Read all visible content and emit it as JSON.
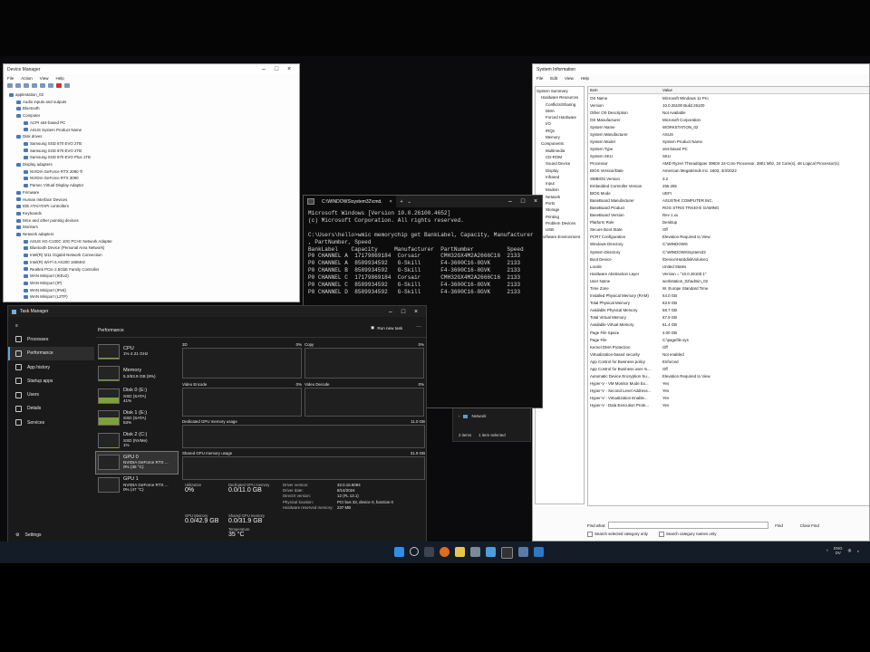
{
  "device_manager": {
    "title": "Device Manager",
    "menu": [
      "File",
      "Action",
      "View",
      "Help"
    ],
    "tree": [
      {
        "label": "applestation_02",
        "indent": 0
      },
      {
        "label": "Audio inputs and outputs",
        "indent": 1
      },
      {
        "label": "Bluetooth",
        "indent": 1
      },
      {
        "label": "Computer",
        "indent": 1
      },
      {
        "label": "ACPI x64-based PC",
        "indent": 2
      },
      {
        "label": "ASUS System Product Name",
        "indent": 2
      },
      {
        "label": "Disk drives",
        "indent": 1
      },
      {
        "label": "Samsung SSD 870 EVO 2TB",
        "indent": 2
      },
      {
        "label": "Samsung SSD 870 EVO 2TB",
        "indent": 2
      },
      {
        "label": "Samsung SSD 970 EVO Plus 1TB",
        "indent": 2
      },
      {
        "label": "Display adapters",
        "indent": 1
      },
      {
        "label": "NVIDIA GeForce RTX 2080 Ti",
        "indent": 2
      },
      {
        "label": "NVIDIA GeForce RTX 3090",
        "indent": 2
      },
      {
        "label": "Parsec Virtual Display Adapter",
        "indent": 2
      },
      {
        "label": "Firmware",
        "indent": 1
      },
      {
        "label": "Human Interface Devices",
        "indent": 1
      },
      {
        "label": "IDE ATA/ATAPI controllers",
        "indent": 1
      },
      {
        "label": "Keyboards",
        "indent": 1
      },
      {
        "label": "Mice and other pointing devices",
        "indent": 1
      },
      {
        "label": "Monitors",
        "indent": 1
      },
      {
        "label": "Network adapters",
        "indent": 1
      },
      {
        "label": "ASUS XG-C100C 10G PCI-E Network Adapter",
        "indent": 2
      },
      {
        "label": "Bluetooth Device (Personal Area Network)",
        "indent": 2
      },
      {
        "label": "Intel(R) I211 Gigabit Network Connection",
        "indent": 2
      },
      {
        "label": "Intel(R) Wi-Fi 6 AX200 160MHz",
        "indent": 2
      },
      {
        "label": "Realtek PCIe 2.5GbE Family Controller",
        "indent": 2
      },
      {
        "label": "WAN Miniport (IKEv2)",
        "indent": 2
      },
      {
        "label": "WAN Miniport (IP)",
        "indent": 2
      },
      {
        "label": "WAN Miniport (IPv6)",
        "indent": 2
      },
      {
        "label": "WAN Miniport (L2TP)",
        "indent": 2
      }
    ]
  },
  "system_info": {
    "title": "System Information",
    "menu": [
      "File",
      "Edit",
      "View",
      "Help"
    ],
    "tree": [
      {
        "label": "System Summary",
        "indent": 0
      },
      {
        "label": "Hardware Resources",
        "indent": 1
      },
      {
        "label": "Conflicts/Sharing",
        "indent": 2
      },
      {
        "label": "DMA",
        "indent": 2
      },
      {
        "label": "Forced Hardware",
        "indent": 2
      },
      {
        "label": "I/O",
        "indent": 2
      },
      {
        "label": "IRQs",
        "indent": 2
      },
      {
        "label": "Memory",
        "indent": 2
      },
      {
        "label": "Components",
        "indent": 1
      },
      {
        "label": "Multimedia",
        "indent": 2
      },
      {
        "label": "CD-ROM",
        "indent": 2
      },
      {
        "label": "Sound Device",
        "indent": 2
      },
      {
        "label": "Display",
        "indent": 2
      },
      {
        "label": "Infrared",
        "indent": 2
      },
      {
        "label": "Input",
        "indent": 2
      },
      {
        "label": "Modem",
        "indent": 2
      },
      {
        "label": "Network",
        "indent": 2
      },
      {
        "label": "Ports",
        "indent": 2
      },
      {
        "label": "Storage",
        "indent": 2
      },
      {
        "label": "Printing",
        "indent": 2
      },
      {
        "label": "Problem Devices",
        "indent": 2
      },
      {
        "label": "USB",
        "indent": 2
      },
      {
        "label": "Software Environment",
        "indent": 1
      }
    ],
    "columns": [
      "Item",
      "Value"
    ],
    "rows": [
      [
        "OS Name",
        "Microsoft Windows 11 Pro"
      ],
      [
        "Version",
        "10.0.26100 Build 26100"
      ],
      [
        "Other OS Description",
        "Not Available"
      ],
      [
        "OS Manufacturer",
        "Microsoft Corporation"
      ],
      [
        "System Name",
        "WORKSTATION_02"
      ],
      [
        "System Manufacturer",
        "ASUS"
      ],
      [
        "System Model",
        "System Product Name"
      ],
      [
        "System Type",
        "x64-based PC"
      ],
      [
        "System SKU",
        "SKU"
      ],
      [
        "Processor",
        "AMD Ryzen Threadripper 3960X 24-Core Processor, 3801 Mhz, 24 Core(s), 48 Logical Processor(s)"
      ],
      [
        "BIOS Version/Date",
        "American Megatrends Inc. 1603, 3/4/2022"
      ],
      [
        "SMBIOS Version",
        "3.2"
      ],
      [
        "Embedded Controller Version",
        "255.255"
      ],
      [
        "BIOS Mode",
        "UEFI"
      ],
      [
        "BaseBoard Manufacturer",
        "ASUSTeK COMPUTER INC."
      ],
      [
        "BaseBoard Product",
        "ROG STRIX TRX40-E GAMING"
      ],
      [
        "BaseBoard Version",
        "Rev 1.xx"
      ],
      [
        "Platform Role",
        "Desktop"
      ],
      [
        "Secure Boot State",
        "Off"
      ],
      [
        "PCR7 Configuration",
        "Elevation Required to View"
      ],
      [
        "Windows Directory",
        "C:\\WINDOWS"
      ],
      [
        "System Directory",
        "C:\\WINDOWS\\system32"
      ],
      [
        "Boot Device",
        "\\Device\\HarddiskVolume1"
      ],
      [
        "Locale",
        "United States"
      ],
      [
        "Hardware Abstraction Layer",
        "Version = \"10.0.26100.1\""
      ],
      [
        "User Name",
        "workstation_02\\admin_02"
      ],
      [
        "Time Zone",
        "W. Europe Standard Time"
      ],
      [
        "Installed Physical Memory (RAM)",
        "64.0 GB"
      ],
      [
        "Total Physical Memory",
        "63.9 GB"
      ],
      [
        "Available Physical Memory",
        "58.7 GB"
      ],
      [
        "Total Virtual Memory",
        "67.9 GB"
      ],
      [
        "Available Virtual Memory",
        "61.4 GB"
      ],
      [
        "Page File Space",
        "4.00 GB"
      ],
      [
        "Page File",
        "C:\\pagefile.sys"
      ],
      [
        "Kernel DMA Protection",
        "Off"
      ],
      [
        "Virtualization-based security",
        "Not enabled"
      ],
      [
        "App Control for Business policy",
        "Enforced"
      ],
      [
        "App Control for Business user m...",
        "Off"
      ],
      [
        "Automatic Device Encryption Su...",
        "Elevation Required to View"
      ],
      [
        "Hyper-V - VM Monitor Mode Ex...",
        "Yes"
      ],
      [
        "Hyper-V - Second Level Address...",
        "Yes"
      ],
      [
        "Hyper-V - Virtualization Enable...",
        "Yes"
      ],
      [
        "Hyper-V - Data Execution Prote...",
        "Yes"
      ]
    ],
    "find_label": "Find what:",
    "find_button": "Find",
    "close_find_button": "Close Find",
    "check_selected": "Search selected category only",
    "check_names": "Search category names only"
  },
  "cmd": {
    "tab_title": "C:\\WINDOWS\\system32\\cmd.",
    "lines": [
      "Microsoft Windows [Version 10.0.26100.4652]",
      "(c) Microsoft Corporation. All rights reserved.",
      "",
      "C:\\Users\\hello>wmic memorychip get BankLabel, Capacity, Manufacturer",
      ", PartNumber, Speed",
      "BankLabel    Capacity     Manufacturer  PartNumber          Speed",
      "P0 CHANNEL A  17179869184  Corsair      CMH32GX4M2A2666C16  2133",
      "P0 CHANNEL A  8589934592   G-Skill      F4-3600C16-8GVK     2133",
      "P0 CHANNEL B  8589934592   G-Skill      F4-3600C16-8GVK     2133",
      "P0 CHANNEL C  17179869184  Corsair      CMH32GX4M2A2666C16  2133",
      "P0 CHANNEL C  8589934592   G-Skill      F4-3600C16-8GVK     2133",
      "P0 CHANNEL D  8589934592   G-Skill      F4-3600C16-8GVK     2133"
    ]
  },
  "explorer": {
    "item": "Network",
    "status_count": "2 items",
    "status_selected": "1 item selected"
  },
  "task_manager": {
    "title": "Task Manager",
    "section": "Performance",
    "run_task": "Run new task",
    "nav": [
      "Processes",
      "Performance",
      "App history",
      "Startup apps",
      "Users",
      "Details",
      "Services"
    ],
    "settings": "Settings",
    "resources": [
      {
        "name": "CPU",
        "sub": "1% 4.21 GHz",
        "fill": 0.02
      },
      {
        "name": "Memory",
        "sub": "5.2/63.9 GB (8%)",
        "fill": 0.08
      },
      {
        "name": "Disk 0 (E:)",
        "sub": "SSD (SATA)",
        "sub2": "41%",
        "fill": 0.41
      },
      {
        "name": "Disk 1 (E:)",
        "sub": "SSD (SATA)",
        "sub2": "53%",
        "fill": 0.53
      },
      {
        "name": "Disk 2 (C:)",
        "sub": "SSD (NVMe)",
        "sub2": "1%",
        "fill": 0.01
      },
      {
        "name": "GPU 0",
        "sub": "NVIDIA GeForce RTX ...",
        "sub2": "0% (35 °C)",
        "fill": 0
      },
      {
        "name": "GPU 1",
        "sub": "NVIDIA GeForce RTX ...",
        "sub2": "0% (47 °C)",
        "fill": 0
      }
    ],
    "graphs": {
      "g3d": "3D",
      "g3d_pct": "0%",
      "copy": "Copy",
      "copy_pct": "0%",
      "venc": "Video Encode",
      "venc_pct": "0%",
      "vdec": "Video Decode",
      "vdec_pct": "0%",
      "dedicated": "Dedicated GPU memory usage",
      "dedicated_max": "11.0 GB",
      "shared": "Shared GPU memory usage",
      "shared_max": "31.9 GB"
    },
    "stats": {
      "utilization_label": "Utilization",
      "utilization": "0%",
      "ded_label": "Dedicated GPU memory",
      "ded": "0.0/11.0 GB",
      "gpu_mem_label": "GPU Memory",
      "gpu_mem": "0.0/42.9 GB",
      "shared_label": "Shared GPU memory",
      "shared": "0.0/31.9 GB",
      "temp_label": "Temperature",
      "temp": "35 °C",
      "details": [
        [
          "Driver version:",
          "32.0.15.6094"
        ],
        [
          "Driver date:",
          "8/14/2024"
        ],
        [
          "DirectX version:",
          "12 (FL 12.1)"
        ],
        [
          "Physical location:",
          "PCI bus 33, device 0, function 0"
        ],
        [
          "Hardware reserved memory:",
          "237 MB"
        ]
      ]
    }
  },
  "taskbar": {
    "lang": "ENG",
    "region": "DV"
  }
}
